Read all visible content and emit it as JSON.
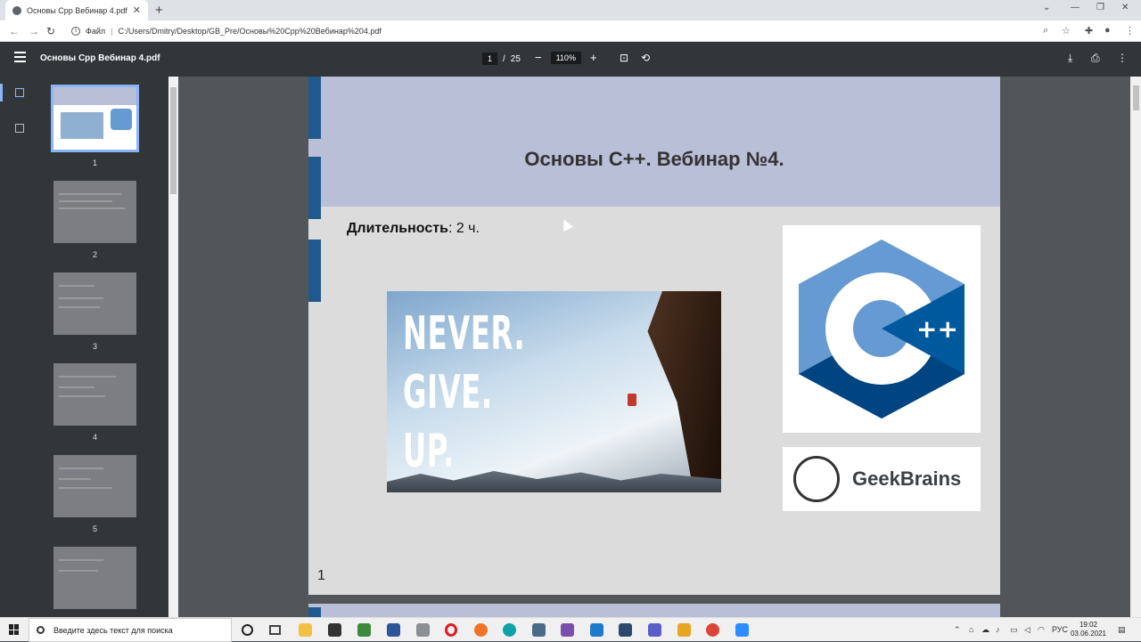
{
  "browser": {
    "tab_title": "Основы Cpp Вебинар 4.pdf",
    "address_label": "Файл",
    "url": "C:/Users/Dmitry/Desktop/GB_Pre/Основы%20Cpp%20Вебинар%204.pdf"
  },
  "pdf_toolbar": {
    "title": "Основы Cpp Вебинар 4.pdf",
    "current_page": "1",
    "page_separator": "/",
    "total_pages": "25",
    "zoom": "110%",
    "zoom_out": "−",
    "zoom_in": "+"
  },
  "thumbnails": [
    {
      "label": "1"
    },
    {
      "label": "2"
    },
    {
      "label": "3"
    },
    {
      "label": "4"
    },
    {
      "label": "5"
    }
  ],
  "slide": {
    "title": "Основы C++. Вебинар №4.",
    "duration_label": "Длительность",
    "duration_value": ": 2 ч.",
    "photo_line1": "NEVER.",
    "photo_line2": "GIVE.",
    "photo_line3": "UP.",
    "logo_text": "GeekBrains",
    "page_number": "1",
    "cpp_color_light": "#659ad2",
    "cpp_color_dark": "#004482",
    "cpp_color_mid": "#00599c"
  },
  "taskbar": {
    "search_placeholder": "Введите здесь текст для поиска",
    "language": "РУС",
    "time": "19:02",
    "date": "03.06.2021"
  }
}
